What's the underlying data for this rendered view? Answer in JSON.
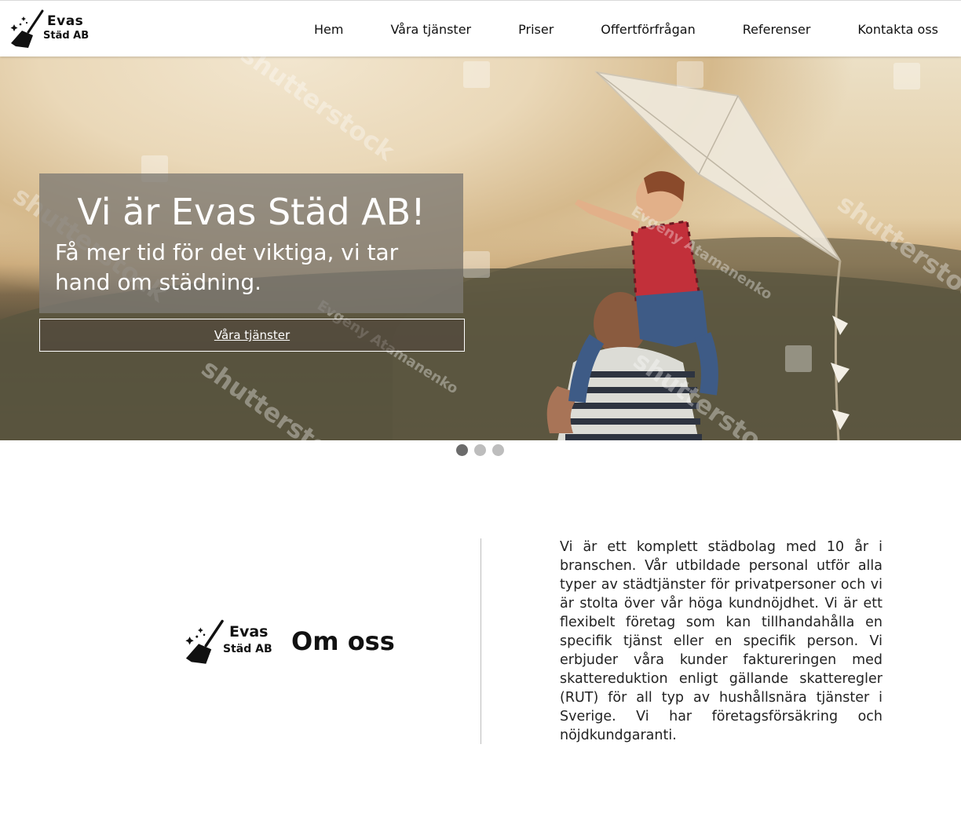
{
  "brand": {
    "name_line1": "Evas",
    "name_line2": "Städ AB"
  },
  "nav": {
    "items": [
      "Hem",
      "Våra tjänster",
      "Priser",
      "Offertförfrågan",
      "Referenser",
      "Kontakta oss"
    ]
  },
  "hero": {
    "title": "Vi är Evas Städ AB!",
    "subtitle": "Få mer tid för det viktiga, vi tar hand om städning.",
    "button_label": "Våra tjänster",
    "slides_total": 3,
    "active_slide": 1,
    "watermark_texts": [
      "shutterstock",
      "Evgeny Atamanenko"
    ]
  },
  "about": {
    "title": "Om oss",
    "text": "Vi är ett komplett städbolag med 10 år i branschen. Vår utbildade personal utför alla typer av städtjänster för privatpersoner och vi är stolta över vår höga kundnöjdhet. Vi är ett flexibelt företag som kan tillhandahålla en specifik tjänst eller en specifik person. Vi erbjuder våra kunder faktureringen med skattereduktion enligt gällande skatteregler (RUT) för all typ av hushållsnära tjänster i Sverige. Vi har företagsförsäkring och nöjdkundgaranti."
  },
  "icons": {
    "logo": "broom-sparkles-icon"
  },
  "colors": {
    "header_bg": "#ffffff",
    "hero_box": "#7d7a73",
    "dot_active": "#6b6b6b",
    "dot_inactive": "#bdbdbd"
  }
}
